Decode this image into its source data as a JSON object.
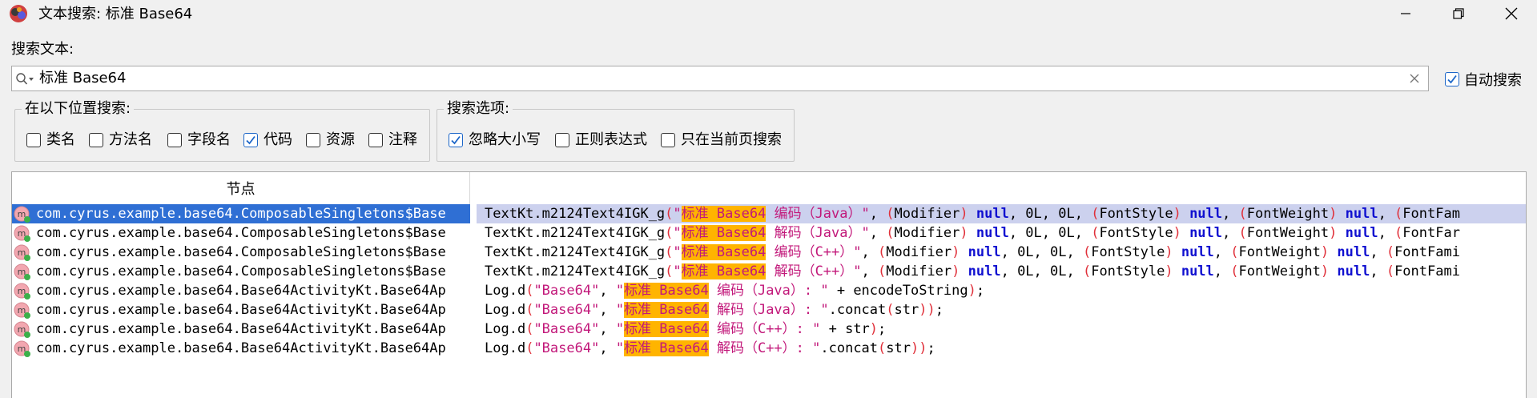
{
  "window": {
    "title": "文本搜索: 标准 Base64",
    "app_icon": "jadx-logo-icon",
    "controls": [
      "minimize-icon",
      "restore-icon",
      "close-icon"
    ]
  },
  "search": {
    "label": "搜索文本:",
    "value": "标准 Base64",
    "auto_search_label": "自动搜索",
    "auto_search_checked": true
  },
  "location_group": {
    "title": "在以下位置搜索:",
    "options": [
      {
        "label": "类名",
        "checked": false
      },
      {
        "label": "方法名",
        "checked": false
      },
      {
        "label": "字段名",
        "checked": false
      },
      {
        "label": "代码",
        "checked": true
      },
      {
        "label": "资源",
        "checked": false
      },
      {
        "label": "注释",
        "checked": false
      }
    ]
  },
  "options_group": {
    "title": "搜索选项:",
    "options": [
      {
        "label": "忽略大小写",
        "checked": true
      },
      {
        "label": "正则表达式",
        "checked": false
      },
      {
        "label": "只在当前页搜索",
        "checked": false
      }
    ]
  },
  "results": {
    "column_node": "节点",
    "colors": {
      "selected_node": "#2f6fd4",
      "selected_code": "#ccd1ee",
      "highlight": "#ffb400"
    },
    "rows": [
      {
        "node": "com.cyrus.example.base64.ComposableSingletons$Base",
        "selected": true,
        "code": [
          {
            "t": "c",
            "v": "TextKt.m2124Text4IGK_g"
          },
          {
            "t": "p",
            "v": "("
          },
          {
            "t": "s",
            "v": "\""
          },
          {
            "t": "hl",
            "v": "标准 Base64"
          },
          {
            "t": "s",
            "v": " 编码（Java）\""
          },
          {
            "t": "c",
            "v": ", "
          },
          {
            "t": "p",
            "v": "("
          },
          {
            "t": "c",
            "v": "Modifier"
          },
          {
            "t": "p",
            "v": ")"
          },
          {
            "t": "c",
            "v": " "
          },
          {
            "t": "kw",
            "v": "null"
          },
          {
            "t": "c",
            "v": ", 0L, 0L, "
          },
          {
            "t": "p",
            "v": "("
          },
          {
            "t": "c",
            "v": "FontStyle"
          },
          {
            "t": "p",
            "v": ")"
          },
          {
            "t": "c",
            "v": " "
          },
          {
            "t": "kw",
            "v": "null"
          },
          {
            "t": "c",
            "v": ", "
          },
          {
            "t": "p",
            "v": "("
          },
          {
            "t": "c",
            "v": "FontWeight"
          },
          {
            "t": "p",
            "v": ")"
          },
          {
            "t": "c",
            "v": " "
          },
          {
            "t": "kw",
            "v": "null"
          },
          {
            "t": "c",
            "v": ", "
          },
          {
            "t": "p",
            "v": "("
          },
          {
            "t": "c",
            "v": "FontFam"
          }
        ]
      },
      {
        "node": "com.cyrus.example.base64.ComposableSingletons$Base",
        "selected": false,
        "code": [
          {
            "t": "c",
            "v": "TextKt.m2124Text4IGK_g"
          },
          {
            "t": "p",
            "v": "("
          },
          {
            "t": "s",
            "v": "\""
          },
          {
            "t": "hl",
            "v": "标准 Base64"
          },
          {
            "t": "s",
            "v": " 解码（Java）\""
          },
          {
            "t": "c",
            "v": ", "
          },
          {
            "t": "p",
            "v": "("
          },
          {
            "t": "c",
            "v": "Modifier"
          },
          {
            "t": "p",
            "v": ")"
          },
          {
            "t": "c",
            "v": " "
          },
          {
            "t": "kw",
            "v": "null"
          },
          {
            "t": "c",
            "v": ", 0L, 0L, "
          },
          {
            "t": "p",
            "v": "("
          },
          {
            "t": "c",
            "v": "FontStyle"
          },
          {
            "t": "p",
            "v": ")"
          },
          {
            "t": "c",
            "v": " "
          },
          {
            "t": "kw",
            "v": "null"
          },
          {
            "t": "c",
            "v": ", "
          },
          {
            "t": "p",
            "v": "("
          },
          {
            "t": "c",
            "v": "FontWeight"
          },
          {
            "t": "p",
            "v": ")"
          },
          {
            "t": "c",
            "v": " "
          },
          {
            "t": "kw",
            "v": "null"
          },
          {
            "t": "c",
            "v": ", "
          },
          {
            "t": "p",
            "v": "("
          },
          {
            "t": "c",
            "v": "FontFar"
          }
        ]
      },
      {
        "node": "com.cyrus.example.base64.ComposableSingletons$Base",
        "selected": false,
        "code": [
          {
            "t": "c",
            "v": "TextKt.m2124Text4IGK_g"
          },
          {
            "t": "p",
            "v": "("
          },
          {
            "t": "s",
            "v": "\""
          },
          {
            "t": "hl",
            "v": "标准 Base64"
          },
          {
            "t": "s",
            "v": " 编码（C++）\""
          },
          {
            "t": "c",
            "v": ", "
          },
          {
            "t": "p",
            "v": "("
          },
          {
            "t": "c",
            "v": "Modifier"
          },
          {
            "t": "p",
            "v": ")"
          },
          {
            "t": "c",
            "v": " "
          },
          {
            "t": "kw",
            "v": "null"
          },
          {
            "t": "c",
            "v": ", 0L, 0L, "
          },
          {
            "t": "p",
            "v": "("
          },
          {
            "t": "c",
            "v": "FontStyle"
          },
          {
            "t": "p",
            "v": ")"
          },
          {
            "t": "c",
            "v": " "
          },
          {
            "t": "kw",
            "v": "null"
          },
          {
            "t": "c",
            "v": ", "
          },
          {
            "t": "p",
            "v": "("
          },
          {
            "t": "c",
            "v": "FontWeight"
          },
          {
            "t": "p",
            "v": ")"
          },
          {
            "t": "c",
            "v": " "
          },
          {
            "t": "kw",
            "v": "null"
          },
          {
            "t": "c",
            "v": ", "
          },
          {
            "t": "p",
            "v": "("
          },
          {
            "t": "c",
            "v": "FontFami"
          }
        ]
      },
      {
        "node": "com.cyrus.example.base64.ComposableSingletons$Base",
        "selected": false,
        "code": [
          {
            "t": "c",
            "v": "TextKt.m2124Text4IGK_g"
          },
          {
            "t": "p",
            "v": "("
          },
          {
            "t": "s",
            "v": "\""
          },
          {
            "t": "hl",
            "v": "标准 Base64"
          },
          {
            "t": "s",
            "v": " 解码（C++）\""
          },
          {
            "t": "c",
            "v": ", "
          },
          {
            "t": "p",
            "v": "("
          },
          {
            "t": "c",
            "v": "Modifier"
          },
          {
            "t": "p",
            "v": ")"
          },
          {
            "t": "c",
            "v": " "
          },
          {
            "t": "kw",
            "v": "null"
          },
          {
            "t": "c",
            "v": ", 0L, 0L, "
          },
          {
            "t": "p",
            "v": "("
          },
          {
            "t": "c",
            "v": "FontStyle"
          },
          {
            "t": "p",
            "v": ")"
          },
          {
            "t": "c",
            "v": " "
          },
          {
            "t": "kw",
            "v": "null"
          },
          {
            "t": "c",
            "v": ", "
          },
          {
            "t": "p",
            "v": "("
          },
          {
            "t": "c",
            "v": "FontWeight"
          },
          {
            "t": "p",
            "v": ")"
          },
          {
            "t": "c",
            "v": " "
          },
          {
            "t": "kw",
            "v": "null"
          },
          {
            "t": "c",
            "v": ", "
          },
          {
            "t": "p",
            "v": "("
          },
          {
            "t": "c",
            "v": "FontFami"
          }
        ]
      },
      {
        "node": "com.cyrus.example.base64.Base64ActivityKt.Base64Ap",
        "selected": false,
        "code": [
          {
            "t": "c",
            "v": "Log.d"
          },
          {
            "t": "p",
            "v": "("
          },
          {
            "t": "s",
            "v": "\"Base64\""
          },
          {
            "t": "c",
            "v": ", "
          },
          {
            "t": "s",
            "v": "\""
          },
          {
            "t": "hl",
            "v": "标准 Base64"
          },
          {
            "t": "s",
            "v": " 编码（Java）: \""
          },
          {
            "t": "c",
            "v": " + encodeToString"
          },
          {
            "t": "p",
            "v": ")"
          },
          {
            "t": "c",
            "v": ";"
          }
        ]
      },
      {
        "node": "com.cyrus.example.base64.Base64ActivityKt.Base64Ap",
        "selected": false,
        "code": [
          {
            "t": "c",
            "v": "Log.d"
          },
          {
            "t": "p",
            "v": "("
          },
          {
            "t": "s",
            "v": "\"Base64\""
          },
          {
            "t": "c",
            "v": ", "
          },
          {
            "t": "s",
            "v": "\""
          },
          {
            "t": "hl",
            "v": "标准 Base64"
          },
          {
            "t": "s",
            "v": " 解码（Java）: \""
          },
          {
            "t": "c",
            "v": ".concat"
          },
          {
            "t": "p",
            "v": "("
          },
          {
            "t": "c",
            "v": "str"
          },
          {
            "t": "p",
            "v": "))"
          },
          {
            "t": "c",
            "v": ";"
          }
        ]
      },
      {
        "node": "com.cyrus.example.base64.Base64ActivityKt.Base64Ap",
        "selected": false,
        "code": [
          {
            "t": "c",
            "v": "Log.d"
          },
          {
            "t": "p",
            "v": "("
          },
          {
            "t": "s",
            "v": "\"Base64\""
          },
          {
            "t": "c",
            "v": ", "
          },
          {
            "t": "s",
            "v": "\""
          },
          {
            "t": "hl",
            "v": "标准 Base64"
          },
          {
            "t": "s",
            "v": " 编码（C++）: \""
          },
          {
            "t": "c",
            "v": " + str"
          },
          {
            "t": "p",
            "v": ")"
          },
          {
            "t": "c",
            "v": ";"
          }
        ]
      },
      {
        "node": "com.cyrus.example.base64.Base64ActivityKt.Base64Ap",
        "selected": false,
        "code": [
          {
            "t": "c",
            "v": "Log.d"
          },
          {
            "t": "p",
            "v": "("
          },
          {
            "t": "s",
            "v": "\"Base64\""
          },
          {
            "t": "c",
            "v": ", "
          },
          {
            "t": "s",
            "v": "\""
          },
          {
            "t": "hl",
            "v": "标准 Base64"
          },
          {
            "t": "s",
            "v": " 解码（C++）: \""
          },
          {
            "t": "c",
            "v": ".concat"
          },
          {
            "t": "p",
            "v": "("
          },
          {
            "t": "c",
            "v": "str"
          },
          {
            "t": "p",
            "v": "))"
          },
          {
            "t": "c",
            "v": ";"
          }
        ]
      }
    ]
  }
}
